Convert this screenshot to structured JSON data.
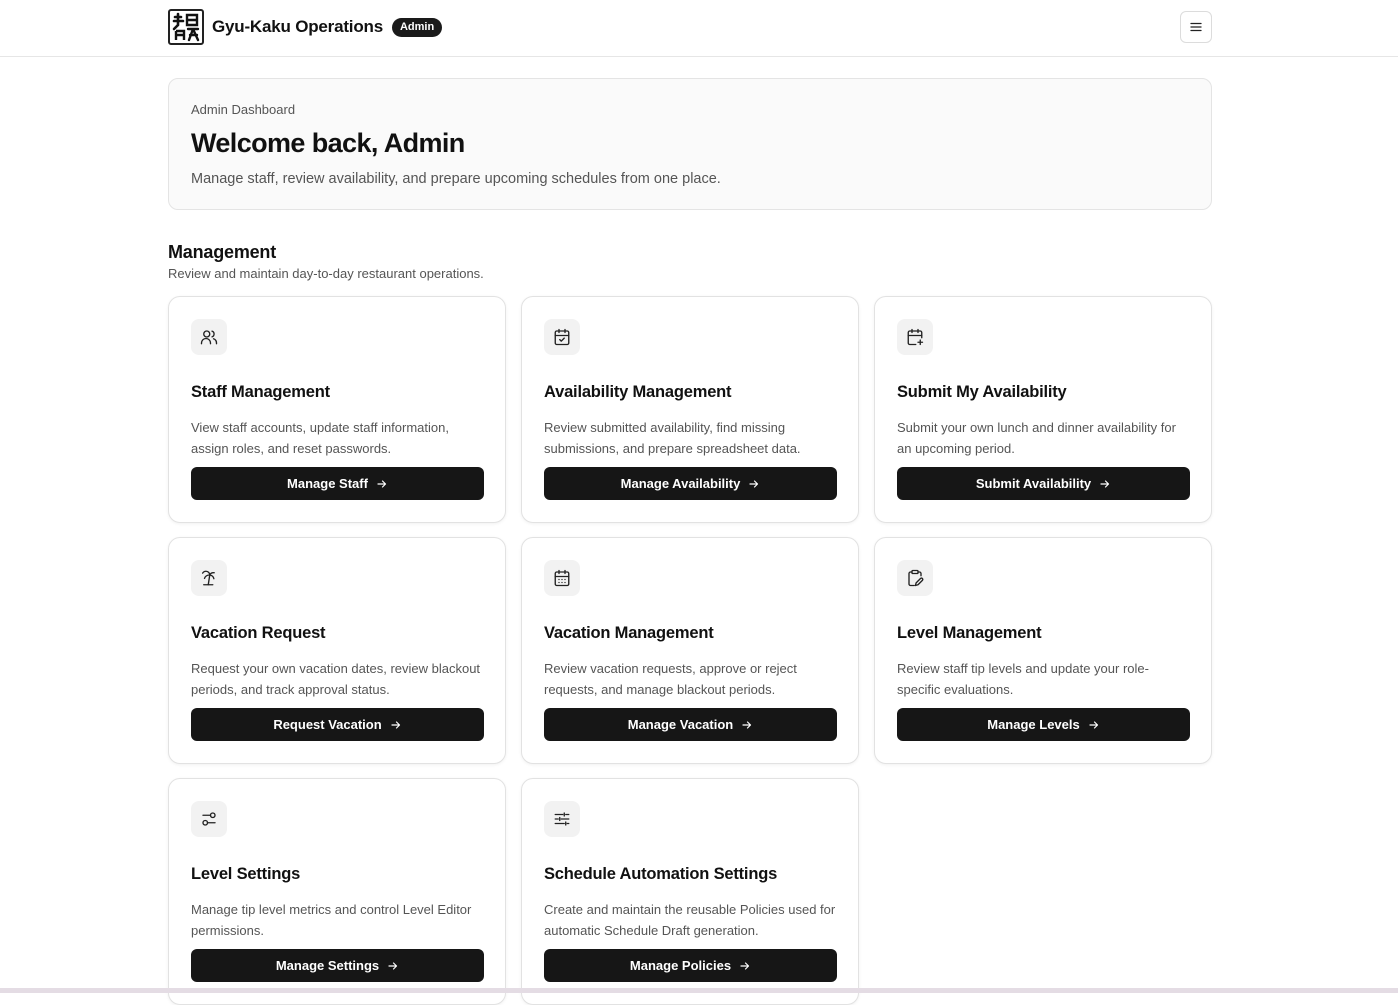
{
  "header": {
    "app_title": "Gyu-Kaku Operations",
    "role_badge": "Admin",
    "logo_text": "牛角",
    "menu_icon": "hamburger-menu-icon"
  },
  "welcome": {
    "eyebrow": "Admin Dashboard",
    "heading": "Welcome back, Admin",
    "subtext": "Manage staff, review availability, and prepare upcoming schedules from one place."
  },
  "management": {
    "title": "Management",
    "subtitle": "Review and maintain day-to-day restaurant operations."
  },
  "cards": [
    {
      "icon": "users-icon",
      "title": "Staff Management",
      "description": "View staff accounts, update staff information, assign roles, and reset passwords.",
      "action": "Manage Staff"
    },
    {
      "icon": "calendar-check-icon",
      "title": "Availability Management",
      "description": "Review submitted availability, find missing submissions, and prepare spreadsheet data.",
      "action": "Manage Availability"
    },
    {
      "icon": "calendar-plus-icon",
      "title": "Submit My Availability",
      "description": "Submit your own lunch and dinner availability for an upcoming period.",
      "action": "Submit Availability"
    },
    {
      "icon": "palm-tree-icon",
      "title": "Vacation Request",
      "description": "Request your own vacation dates, review blackout periods, and track approval status.",
      "action": "Request Vacation"
    },
    {
      "icon": "calendar-days-icon",
      "title": "Vacation Management",
      "description": "Review vacation requests, approve or reject requests, and manage blackout periods.",
      "action": "Manage Vacation"
    },
    {
      "icon": "clipboard-edit-icon",
      "title": "Level Management",
      "description": "Review staff tip levels and update your role-specific evaluations.",
      "action": "Manage Levels"
    },
    {
      "icon": "settings-toggles-icon",
      "title": "Level Settings",
      "description": "Manage tip level metrics and control Level Editor permissions.",
      "action": "Manage Settings"
    },
    {
      "icon": "sliders-icon",
      "title": "Schedule Automation Settings",
      "description": "Create and maintain the reusable Policies used for automatic Schedule Draft generation.",
      "action": "Manage Policies"
    }
  ],
  "colors": {
    "button_bg": "#161616",
    "icon_bg": "#f2f2f2",
    "badge_bg": "#1a1a1a",
    "muted_text": "#555555"
  }
}
